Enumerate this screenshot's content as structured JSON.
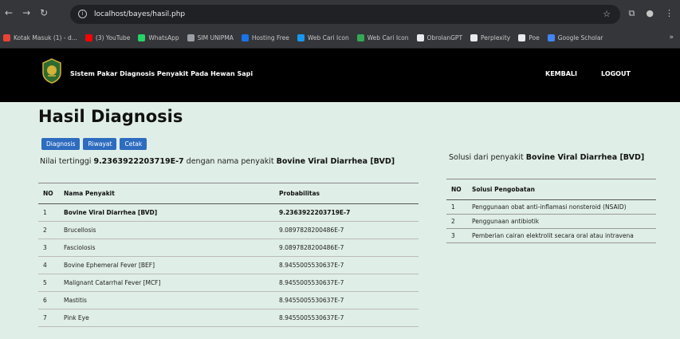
{
  "browser": {
    "url": "localhost/bayes/hasil.php",
    "bookmarks": [
      {
        "label": "Kotak Masuk (1) - d...",
        "icon": "gmail-icon",
        "color": "#ea4335"
      },
      {
        "label": "(3) YouTube",
        "icon": "youtube-icon",
        "color": "#ff0000"
      },
      {
        "label": "WhatsApp",
        "icon": "whatsapp-icon",
        "color": "#25d366"
      },
      {
        "label": "SIM UNIPMA",
        "icon": "globe-icon",
        "color": "#9aa0a6"
      },
      {
        "label": "Hosting Free",
        "icon": "hosting-icon",
        "color": "#1a73e8"
      },
      {
        "label": "Web Cari Icon",
        "icon": "vuetify-icon",
        "color": "#1697f6"
      },
      {
        "label": "Web Cari Icon",
        "icon": "leaf-icon",
        "color": "#34a853"
      },
      {
        "label": "ObrolanGPT",
        "icon": "chatgpt-icon",
        "color": "#e8eaed"
      },
      {
        "label": "Perplexity",
        "icon": "perplexity-icon",
        "color": "#e8eaed"
      },
      {
        "label": "Poe",
        "icon": "poe-icon",
        "color": "#e8eaed"
      },
      {
        "label": "Google Scholar",
        "icon": "scholar-icon",
        "color": "#4285f4"
      }
    ]
  },
  "header": {
    "title": "Sistem Pakar Diagnosis Penyakit Pada Hewan Sapi",
    "menu_kembali": "KEMBALI",
    "menu_logout": "LOGOUT"
  },
  "main": {
    "title": "Hasil Diagnosis",
    "buttons": {
      "diagnosis": "Diagnosis",
      "riwayat": "Riwayat",
      "cetak": "Cetak"
    },
    "result_prefix": "Nilai tertinggi ",
    "result_value": "9.2363922203719E-7",
    "result_mid": " dengan nama penyakit ",
    "result_disease": "Bovine Viral Diarrhea [BVD]",
    "table_headers": {
      "no": "NO",
      "nama": "Nama Penyakit",
      "prob": "Probabilitas"
    },
    "rows": [
      {
        "no": "1",
        "nama": "Bovine Viral Diarrhea [BVD]",
        "prob": "9.2363922203719E-7"
      },
      {
        "no": "2",
        "nama": "Brucellosis",
        "prob": "9.0897828200486E-7"
      },
      {
        "no": "3",
        "nama": "Fasciolosis",
        "prob": "9.0897828200486E-7"
      },
      {
        "no": "4",
        "nama": "Bovine Ephemeral Fever [BEF]",
        "prob": "8.9455005530637E-7"
      },
      {
        "no": "5",
        "nama": "Malignant Catarrhal Fever [MCF]",
        "prob": "8.9455005530637E-7"
      },
      {
        "no": "6",
        "nama": "Mastitis",
        "prob": "8.9455005530637E-7"
      },
      {
        "no": "7",
        "nama": "Pink Eye",
        "prob": "8.9455005530637E-7"
      }
    ]
  },
  "solusi": {
    "prefix": "Solusi dari penyakit ",
    "disease": "Bovine Viral Diarrhea [BVD]",
    "headers": {
      "no": "NO",
      "solusi": "Solusi Pengobatan"
    },
    "rows": [
      {
        "no": "1",
        "text": "Penggunaan obat anti-inflamasi nonsteroid (NSAID)"
      },
      {
        "no": "2",
        "text": "Penggunaan antibiotik"
      },
      {
        "no": "3",
        "text": "Pemberian cairan elektrolit secara oral atau intravena"
      }
    ]
  }
}
